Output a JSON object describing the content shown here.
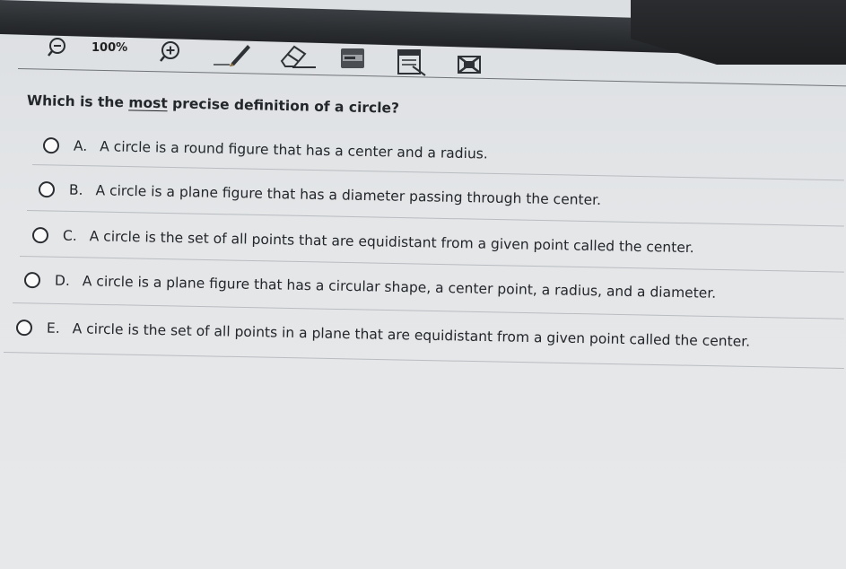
{
  "toolbar": {
    "zoom_level": "100%",
    "zoom_out_icon": "zoom-out-icon",
    "zoom_in_icon": "zoom-in-icon",
    "pen_icon": "pencil-icon",
    "eraser_icon": "eraser-icon",
    "highlighter_icon": "text-highlight-icon",
    "reference_icon": "reference-sheet-icon",
    "eliminate_icon": "answer-eliminator-icon"
  },
  "question": {
    "prefix": "Which is the ",
    "emphasis": "most",
    "suffix": " precise definition of a circle?"
  },
  "options": [
    {
      "letter": "A.",
      "text": "A circle is a round figure that has a center and a radius."
    },
    {
      "letter": "B.",
      "text": "A circle is a plane figure that has a diameter passing through the center."
    },
    {
      "letter": "C.",
      "text": "A circle is the set of all points that are equidistant from a given point called the center."
    },
    {
      "letter": "D.",
      "text": "A circle is a plane figure that has a circular shape, a center point, a radius, and a diameter."
    },
    {
      "letter": "E.",
      "text": "A circle is the set of all points in a plane that are equidistant from a given point called the center."
    }
  ]
}
